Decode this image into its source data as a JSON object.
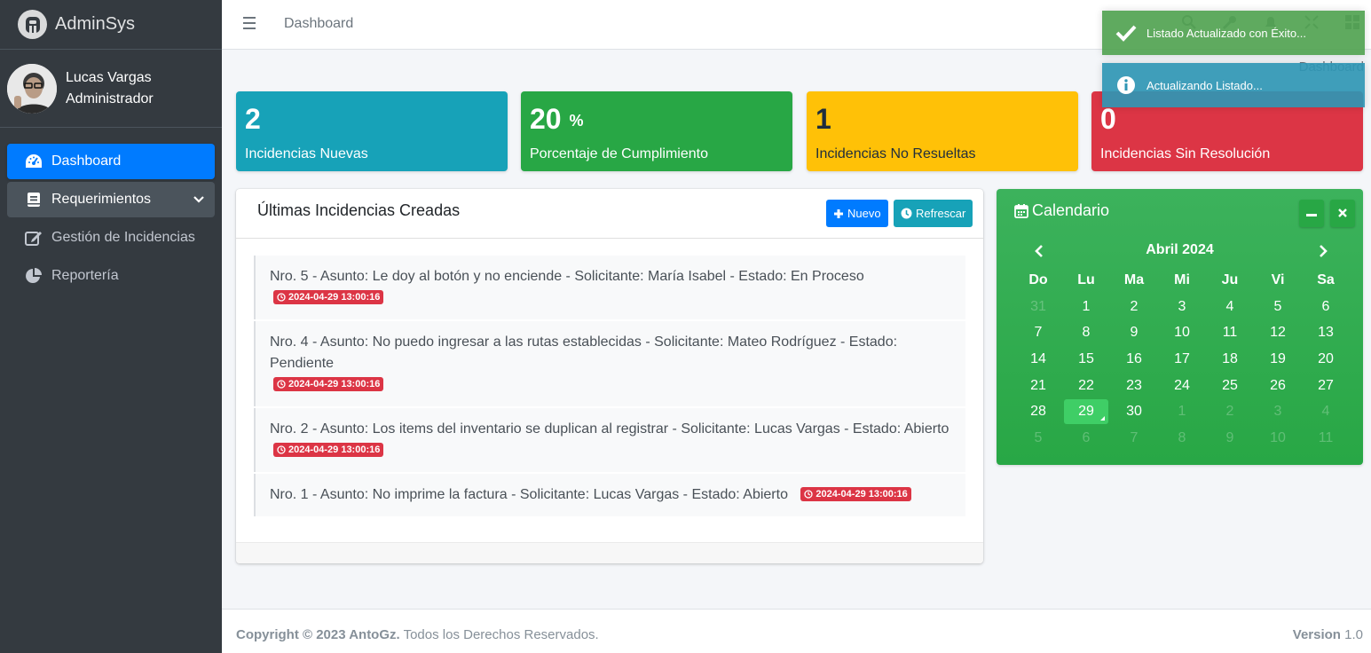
{
  "brand": {
    "name": "AdminSys"
  },
  "user": {
    "name": "Lucas Vargas",
    "role": "Administrador"
  },
  "sidebar": {
    "items": [
      {
        "label": "Dashboard",
        "icon": "tachometer-icon"
      },
      {
        "label": "Requerimientos",
        "icon": "book-icon"
      },
      {
        "label": "Gestión de Incidencias",
        "icon": "edit-icon"
      },
      {
        "label": "Reportería",
        "icon": "pie-chart-icon"
      }
    ]
  },
  "header": {
    "title": "Dashboard",
    "breadcrumb": "Dashboard"
  },
  "toasts": {
    "success": "Listado Actualizado con Éxito...",
    "info": "Actualizando Listado..."
  },
  "stats": [
    {
      "value": "2",
      "label": "Incidencias Nuevas",
      "color": "#17a2b8"
    },
    {
      "value": "20",
      "suffix": "%",
      "label": "Porcentaje de Cumplimiento",
      "color": "#28a745"
    },
    {
      "value": "1",
      "label": "Incidencias No Resueltas",
      "color": "#ffc107"
    },
    {
      "value": "0",
      "label": "Incidencias Sin Resolución",
      "color": "#dc3545"
    }
  ],
  "incidents": {
    "title": "Últimas Incidencias Creadas",
    "new_label": "Nuevo",
    "refresh_label": "Refrescar",
    "items": [
      {
        "text": "Nro. 5 - Asunto: Le doy al botón y no enciende - Solicitante: María Isabel - Estado: En Proceso",
        "date": "2024-04-29 13:00:16"
      },
      {
        "text": "Nro. 4 - Asunto: No puedo ingresar a las rutas establecidas - Solicitante: Mateo Rodríguez - Estado: Pendiente",
        "date": "2024-04-29 13:00:16"
      },
      {
        "text": "Nro. 2 - Asunto: Los items del inventario se duplican al registrar - Solicitante: Lucas Vargas - Estado: Abierto",
        "date": "2024-04-29 13:00:16"
      },
      {
        "text": "Nro. 1 - Asunto: No imprime la factura - Solicitante: Lucas Vargas - Estado: Abierto",
        "date": "2024-04-29 13:00:16"
      }
    ]
  },
  "calendar": {
    "title": "Calendario",
    "month": "Abril 2024",
    "weekdays": [
      "Do",
      "Lu",
      "Ma",
      "Mi",
      "Ju",
      "Vi",
      "Sa"
    ],
    "weeks": [
      [
        "31",
        "1",
        "2",
        "3",
        "4",
        "5",
        "6"
      ],
      [
        "7",
        "8",
        "9",
        "10",
        "11",
        "12",
        "13"
      ],
      [
        "14",
        "15",
        "16",
        "17",
        "18",
        "19",
        "20"
      ],
      [
        "21",
        "22",
        "23",
        "24",
        "25",
        "26",
        "27"
      ],
      [
        "28",
        "29",
        "30",
        "1",
        "2",
        "3",
        "4"
      ],
      [
        "5",
        "6",
        "7",
        "8",
        "9",
        "10",
        "11"
      ]
    ],
    "today": "29"
  },
  "footer": {
    "copyright_bold": "Copyright © 2023 AntoGz.",
    "copyright_rest": "Todos los Derechos Reservados.",
    "version_label": "Version",
    "version": "1.0"
  }
}
